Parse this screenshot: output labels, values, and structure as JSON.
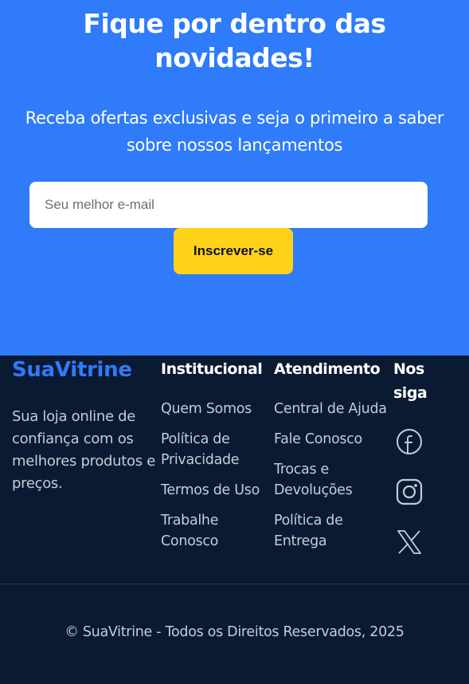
{
  "newsletter": {
    "title_line1": "Fique por dentro das",
    "title_line2": "novidades!",
    "subtitle_line1": "Receba ofertas exclusivas e seja o primeiro a saber",
    "subtitle_line2": "sobre nossos lançamentos",
    "email_placeholder": "Seu melhor e-mail",
    "button_label": "Inscrever-se"
  },
  "footer": {
    "brand": "SuaVitrine",
    "tagline": "Sua loja online de confiança com os melhores produtos e preços.",
    "institucional": {
      "title": "Institucional",
      "links": [
        "Quem Somos",
        "Política de Privacidade",
        "Termos de Uso",
        "Trabalhe Conosco"
      ]
    },
    "atendimento": {
      "title": "Atendimento",
      "links": [
        "Central de Ajuda",
        "Fale Conosco",
        "Trocas e Devoluções",
        "Política de Entrega"
      ]
    },
    "social": {
      "title": "Nos siga",
      "icons": [
        "facebook-icon",
        "instagram-icon",
        "x-twitter-icon"
      ]
    },
    "copyright": "© SuaVitrine - Todos os Direitos Reservados, 2025"
  },
  "colors": {
    "primary": "#2f7bf9",
    "accent": "#ffd21a",
    "footer_bg": "#0a1a33"
  }
}
